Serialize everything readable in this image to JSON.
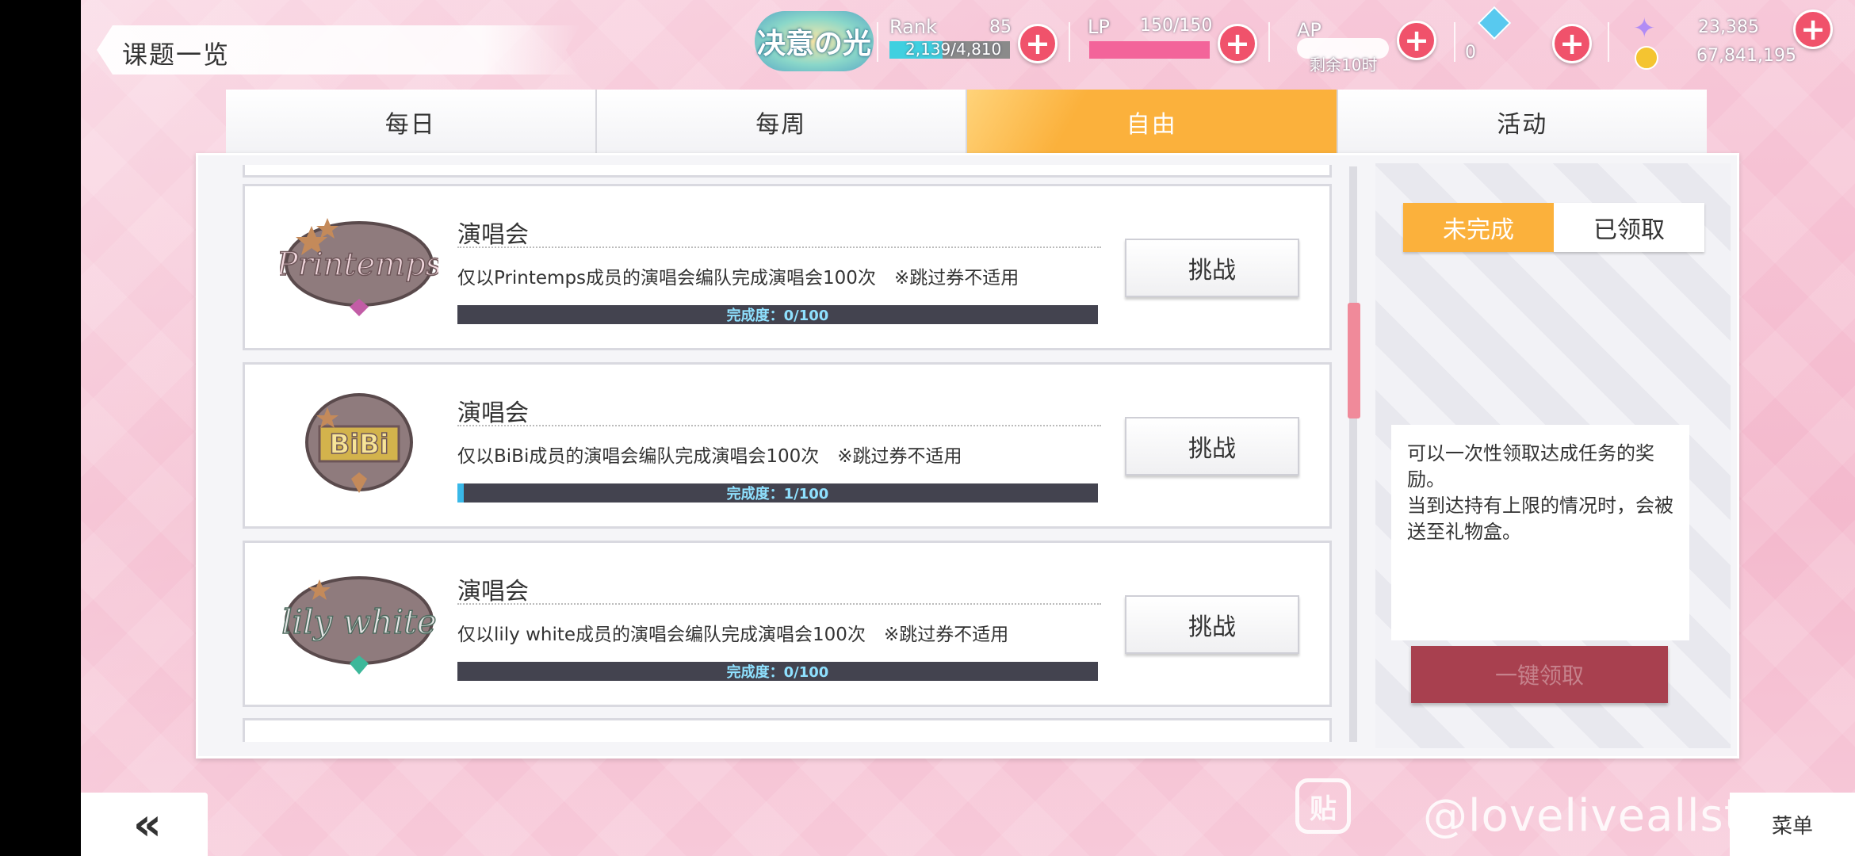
{
  "header": {
    "title": "课题一览",
    "logo_text": "决意の光",
    "rank_label": "Rank",
    "rank_value": "85",
    "exp_text": "2,139/4,810",
    "exp_progress": 0.44,
    "lp_label": "LP",
    "lp_value": "150/150",
    "lp_progress": 1.0,
    "ap_label": "AP",
    "ap_sub": "剩余10时",
    "gem_count": "0",
    "star_gem_count": "23,385",
    "gold_count": "67,841,195"
  },
  "tabs": [
    {
      "label": "每日",
      "active": false
    },
    {
      "label": "每周",
      "active": false
    },
    {
      "label": "自由",
      "active": true
    },
    {
      "label": "活动",
      "active": false
    }
  ],
  "tasks": [
    {
      "emblem": "Printemps",
      "title": "演唱会",
      "desc": "仅以Printemps成员的演唱会编队完成演唱会100次　※跳过券不适用",
      "progress_text": "完成度：0/100",
      "progress": 0.0,
      "button": "挑战"
    },
    {
      "emblem": "BiBi",
      "title": "演唱会",
      "desc": "仅以BiBi成员的演唱会编队完成演唱会100次　※跳过券不适用",
      "progress_text": "完成度：1/100",
      "progress": 0.01,
      "button": "挑战"
    },
    {
      "emblem": "lily white",
      "title": "演唱会",
      "desc": "仅以lily white成员的演唱会编队完成演唱会100次　※跳过券不适用",
      "progress_text": "完成度：0/100",
      "progress": 0.0,
      "button": "挑战"
    }
  ],
  "sidebar": {
    "filter_incomplete": "未完成",
    "filter_claimed": "已领取",
    "note_line1": "可以一次性领取达成任务的奖励。",
    "note_line2": "当到达持有上限的情况时，会被送至礼物盒。",
    "claim_all": "一键领取"
  },
  "footer": {
    "back": "«",
    "menu": "菜单",
    "watermark": "@loveliveallstars吧",
    "watermark_icon": "贴"
  },
  "colors": {
    "accent_orange": "#fbb13c",
    "plus_red": "#f0526b",
    "progress_blue": "#39b8e8",
    "lp_pink": "#f3649a",
    "claim_disabled": "#a8404f"
  }
}
